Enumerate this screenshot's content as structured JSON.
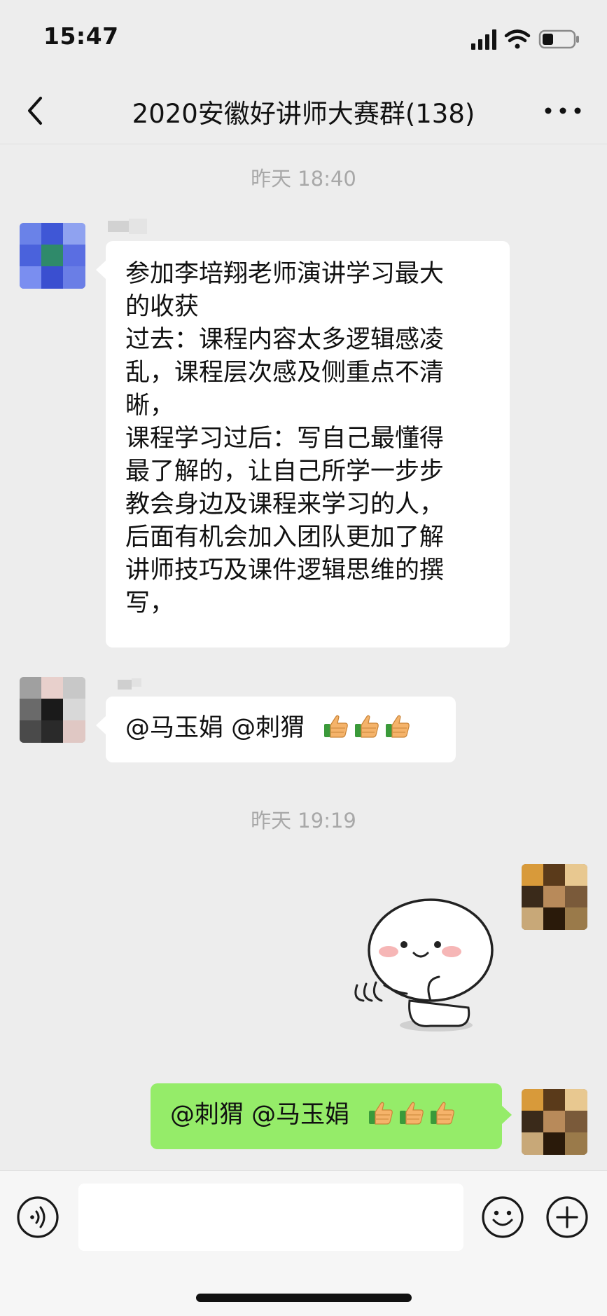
{
  "status_bar": {
    "time": "15:47"
  },
  "header": {
    "title": "2020安徽好讲师大赛群(138)"
  },
  "messages": {
    "ts1": "昨天 18:40",
    "m1_lines": [
      "参加李培翔老师演讲学习最大",
      "的收获",
      "过去：课程内容太多逻辑感凌",
      "乱，课程层次感及侧重点不清",
      "晰，",
      "课程学习过后：写自己最懂得",
      "最了解的，让自己所学一步步",
      "教会身边及课程来学习的人，",
      "后面有机会加入团队更加了解",
      "讲师技巧及课件逻辑思维的撰",
      "写，"
    ],
    "m2_text": "@马玉娟 @刺猬",
    "ts2": "昨天 19:19",
    "m4_text": "@刺猬 @马玉娟"
  },
  "icons": {
    "back": "chevron-left-icon",
    "more": "more-dots-icon",
    "voice": "voice-icon",
    "emoji": "emoji-icon",
    "plus": "plus-icon",
    "thumbs_up": "thumbs-up-icon",
    "sticker": "waving-sticker"
  },
  "colors": {
    "background": "#ededed",
    "sent_bubble": "#95ec69",
    "received_bubble": "#ffffff",
    "timestamp": "#a8a8a8"
  }
}
